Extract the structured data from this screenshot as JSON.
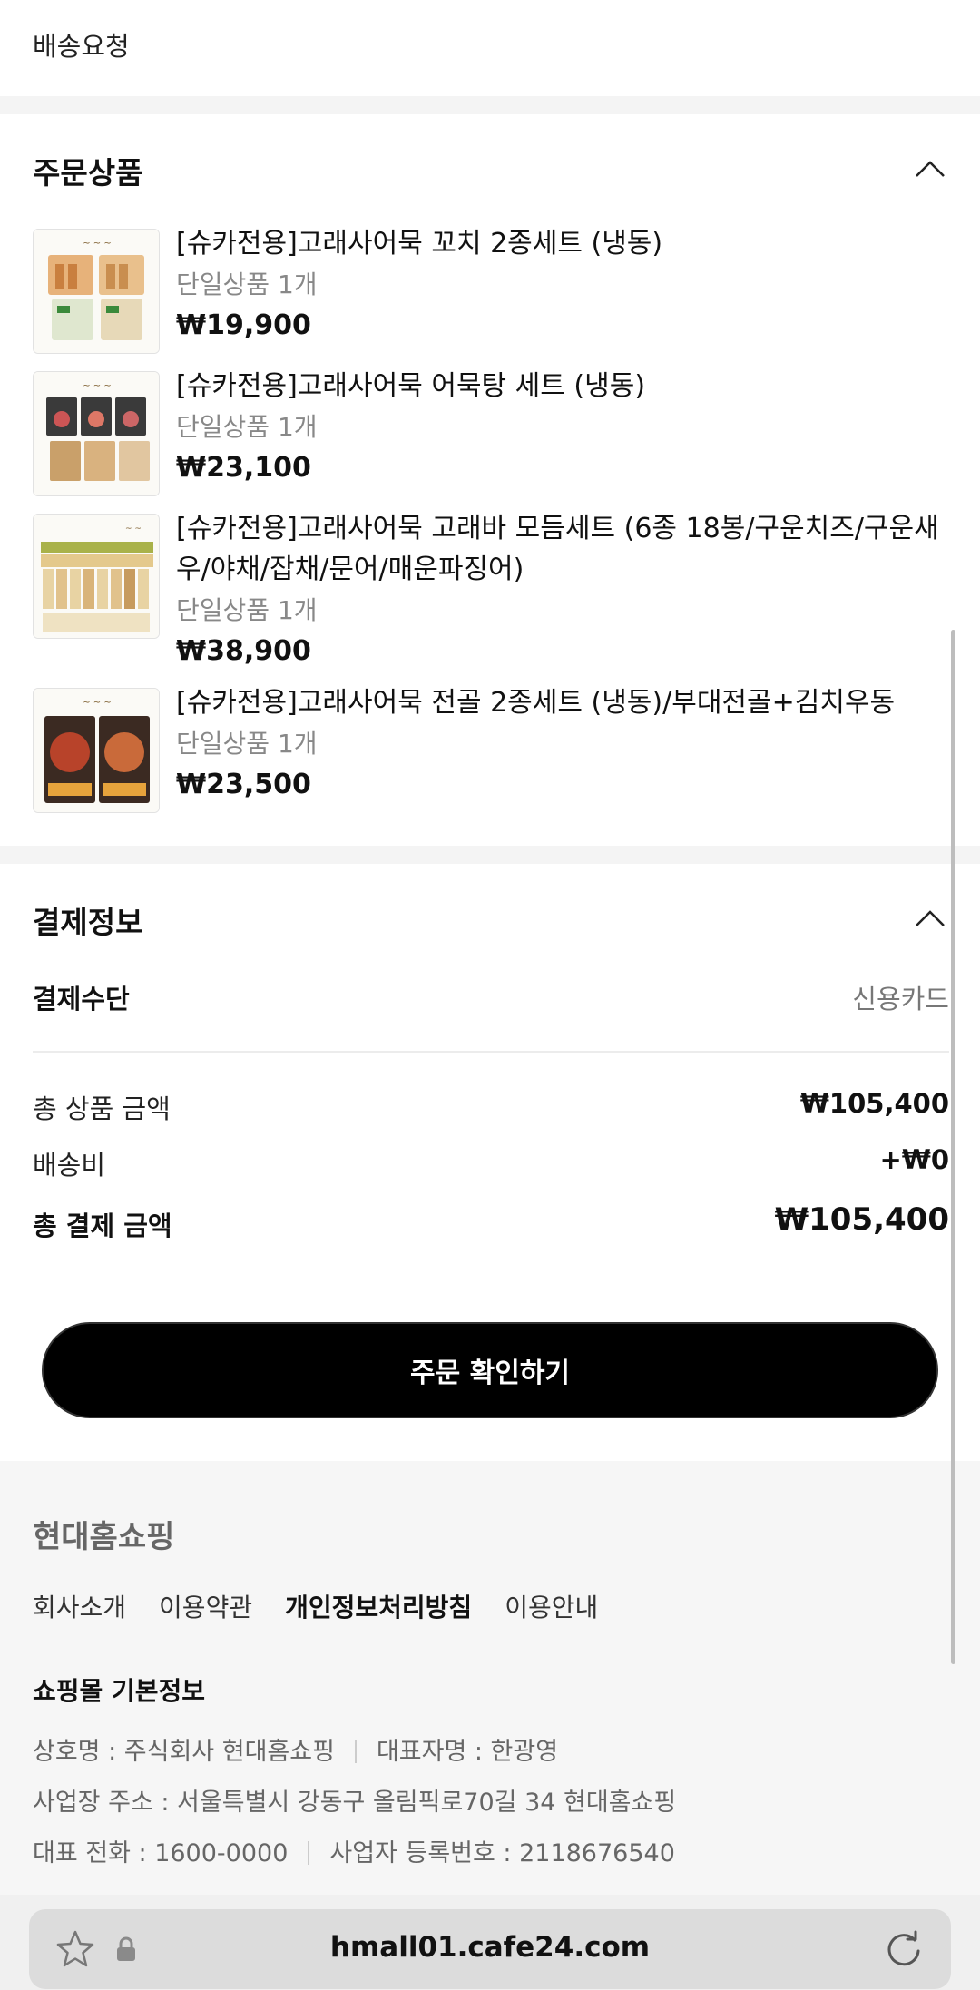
{
  "top": {
    "delivery_request_label": "배송요청"
  },
  "order_products": {
    "title": "주문상품",
    "items": [
      {
        "name": "[슈카전용]고래사어묵 꼬치 2종세트 (냉동)",
        "option": "단일상품 1개",
        "price": "₩19,900"
      },
      {
        "name": "[슈카전용]고래사어묵 어묵탕 세트 (냉동)",
        "option": "단일상품 1개",
        "price": "₩23,100"
      },
      {
        "name": "[슈카전용]고래사어묵 고래바 모듬세트 (6종 18봉/구운치즈/구운새우/야채/잡채/문어/매운파징어)",
        "option": "단일상품 1개",
        "price": "₩38,900"
      },
      {
        "name": "[슈카전용]고래사어묵 전골 2종세트 (냉동)/부대전골+김치우동",
        "option": "단일상품 1개",
        "price": "₩23,500"
      }
    ]
  },
  "payment": {
    "title": "결제정보",
    "method_label": "결제수단",
    "method_value": "신용카드",
    "subtotal_label": "총 상품 금액",
    "subtotal_value": "₩105,400",
    "shipping_label": "배송비",
    "shipping_value": "+₩0",
    "total_label": "총 결제 금액",
    "total_value": "₩105,400"
  },
  "confirm_button_label": "주문 확인하기",
  "footer": {
    "brand": "현대홈쇼핑",
    "links": [
      "회사소개",
      "이용약관",
      "개인정보처리방침",
      "이용안내"
    ],
    "basic_info_title": "쇼핑몰 기본정보",
    "company_name": "상호명 : 주식회사 현대홈쇼핑",
    "ceo": "대표자명 : 한광영",
    "address": "사업장 주소 : 서울특별시 강동구 올림픽로70길 34 현대홈쇼핑",
    "phone": "대표 전화 : 1600-0000",
    "business_no": "사업자 등록번호 : 2118676540"
  },
  "browser": {
    "url": "hmall01.cafe24.com"
  },
  "icons": {
    "chevron": "chevron-up-icon",
    "star": "star-icon",
    "lock": "lock-icon",
    "reload": "reload-icon"
  }
}
